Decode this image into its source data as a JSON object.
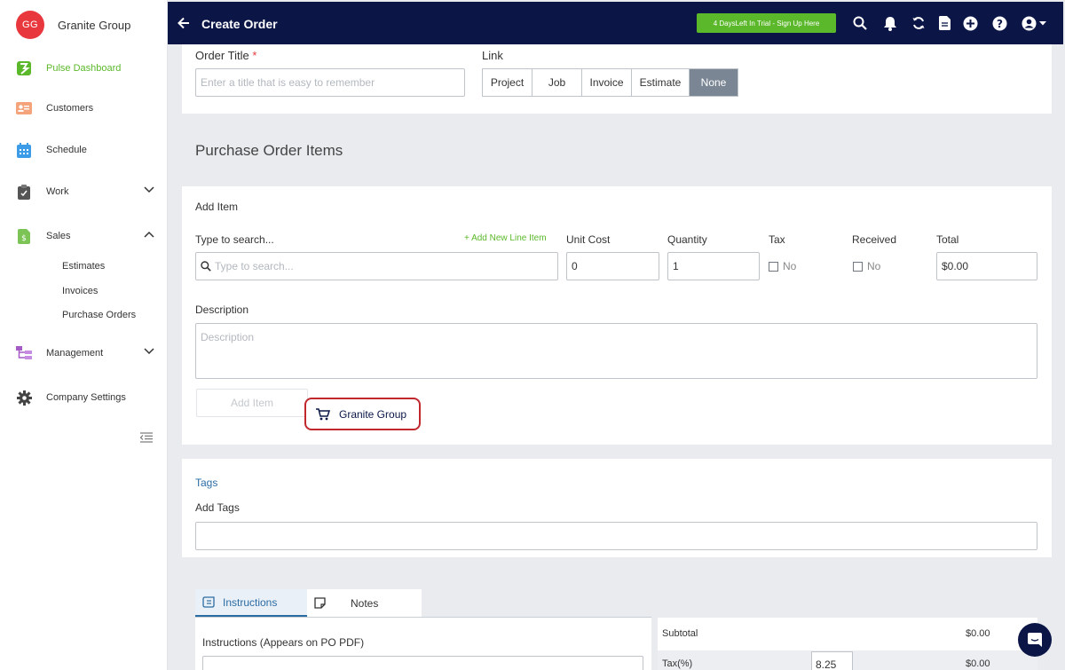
{
  "brand": {
    "initials": "GG",
    "name": "Granite Group"
  },
  "sidebar": {
    "items": [
      {
        "label": "Pulse Dashboard",
        "icon": "pulse-logo-icon"
      },
      {
        "label": "Customers",
        "icon": "customers-card-icon"
      },
      {
        "label": "Schedule",
        "icon": "calendar-icon"
      },
      {
        "label": "Work",
        "icon": "clipboard-icon"
      },
      {
        "label": "Sales",
        "icon": "dollar-document-icon"
      },
      {
        "label": "Management",
        "icon": "org-chart-icon"
      },
      {
        "label": "Company Settings",
        "icon": "gear-icon"
      }
    ],
    "sales_sub": [
      "Estimates",
      "Invoices",
      "Purchase Orders"
    ]
  },
  "topbar": {
    "title": "Create Order",
    "trial": "4 DaysLeft In Trial - Sign Up Here",
    "icons": [
      "search-icon",
      "bell-icon",
      "sync-icon",
      "document-icon",
      "plus-circle-icon",
      "help-icon",
      "user-circle-icon"
    ]
  },
  "order": {
    "title_label": "Order Title",
    "required_mark": "*",
    "title_placeholder": "Enter a title that is easy to remember",
    "link_label": "Link",
    "link_options": [
      "Project",
      "Job",
      "Invoice",
      "Estimate",
      "None"
    ],
    "link_selected": "None"
  },
  "items_section": {
    "title": "Purchase Order Items",
    "add_item_heading": "Add Item",
    "search_label": "Type to search...",
    "add_new_line": "+ Add New Line Item",
    "search_placeholder": "Type to search...",
    "unit_cost_label": "Unit Cost",
    "unit_cost_value": "0",
    "quantity_label": "Quantity",
    "quantity_value": "1",
    "tax_label": "Tax",
    "tax_value": "No",
    "received_label": "Received",
    "received_value": "No",
    "total_label": "Total",
    "total_value": "$0.00",
    "description_label": "Description",
    "description_placeholder": "Description",
    "add_item_button": "Add Item",
    "vendor_button": "Granite Group"
  },
  "tags": {
    "link": "Tags",
    "label": "Add Tags"
  },
  "tabs": {
    "instructions": "Instructions",
    "notes": "Notes",
    "instructions_label": "Instructions (Appears on PO PDF)"
  },
  "totals": {
    "subtotal_label": "Subtotal",
    "subtotal_value": "$0.00",
    "tax_label": "Tax(%)",
    "tax_rate": "8.25",
    "tax_value": "$0.00"
  },
  "colors": {
    "navy": "#0b1647",
    "green": "#5cb82b",
    "red_highlight": "#c0282e",
    "link_blue": "#2b6ca3",
    "selected_gray": "#7a8694"
  }
}
